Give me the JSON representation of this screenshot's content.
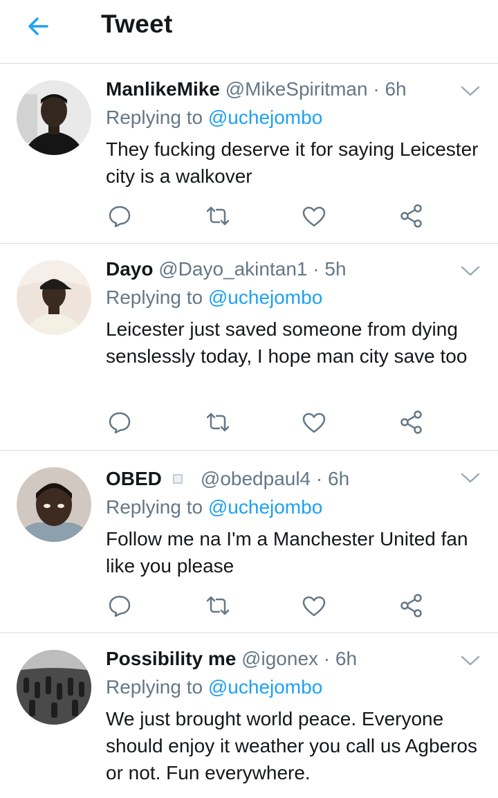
{
  "header": {
    "title": "Tweet",
    "back_icon": "back-arrow-icon",
    "accent": "#1da1f2"
  },
  "colors": {
    "accent": "#1da1f2",
    "secondary_text": "#657786",
    "divider": "#d6dce1",
    "primary_text": "#14171a"
  },
  "tweets": [
    {
      "display_name": "ManlikeMike",
      "handle": "@MikeSpiritman",
      "separator": "·",
      "time": "6h",
      "replying_label": "Replying to",
      "mention": "@uchejombo",
      "text": "They fucking deserve it for saying Leicester city is a walkover"
    },
    {
      "display_name": "Dayo",
      "handle": "@Dayo_akintan1",
      "separator": "·",
      "time": "5h",
      "replying_label": "Replying to",
      "mention": "@uchejombo",
      "text": "Leicester just saved someone from dying senslessly today, I hope man city save too"
    },
    {
      "display_name": "OBED",
      "handle": "@obedpaul4",
      "separator": "·",
      "time": "6h",
      "replying_label": "Replying to",
      "mention": "@uchejombo",
      "text": "Follow me na I'm a Manchester United fan like you please"
    },
    {
      "display_name": "Possibility me",
      "handle": "@igonex",
      "separator": "·",
      "time": "6h",
      "replying_label": "Replying to",
      "mention": "@uchejombo",
      "text": "We just brought world peace. Everyone should enjoy it weather you call us Agberos or not. Fun everywhere."
    }
  ],
  "icons": {
    "reply": "reply-icon",
    "retweet": "retweet-icon",
    "like": "heart-icon",
    "share": "share-icon",
    "caret": "chevron-down-icon"
  }
}
